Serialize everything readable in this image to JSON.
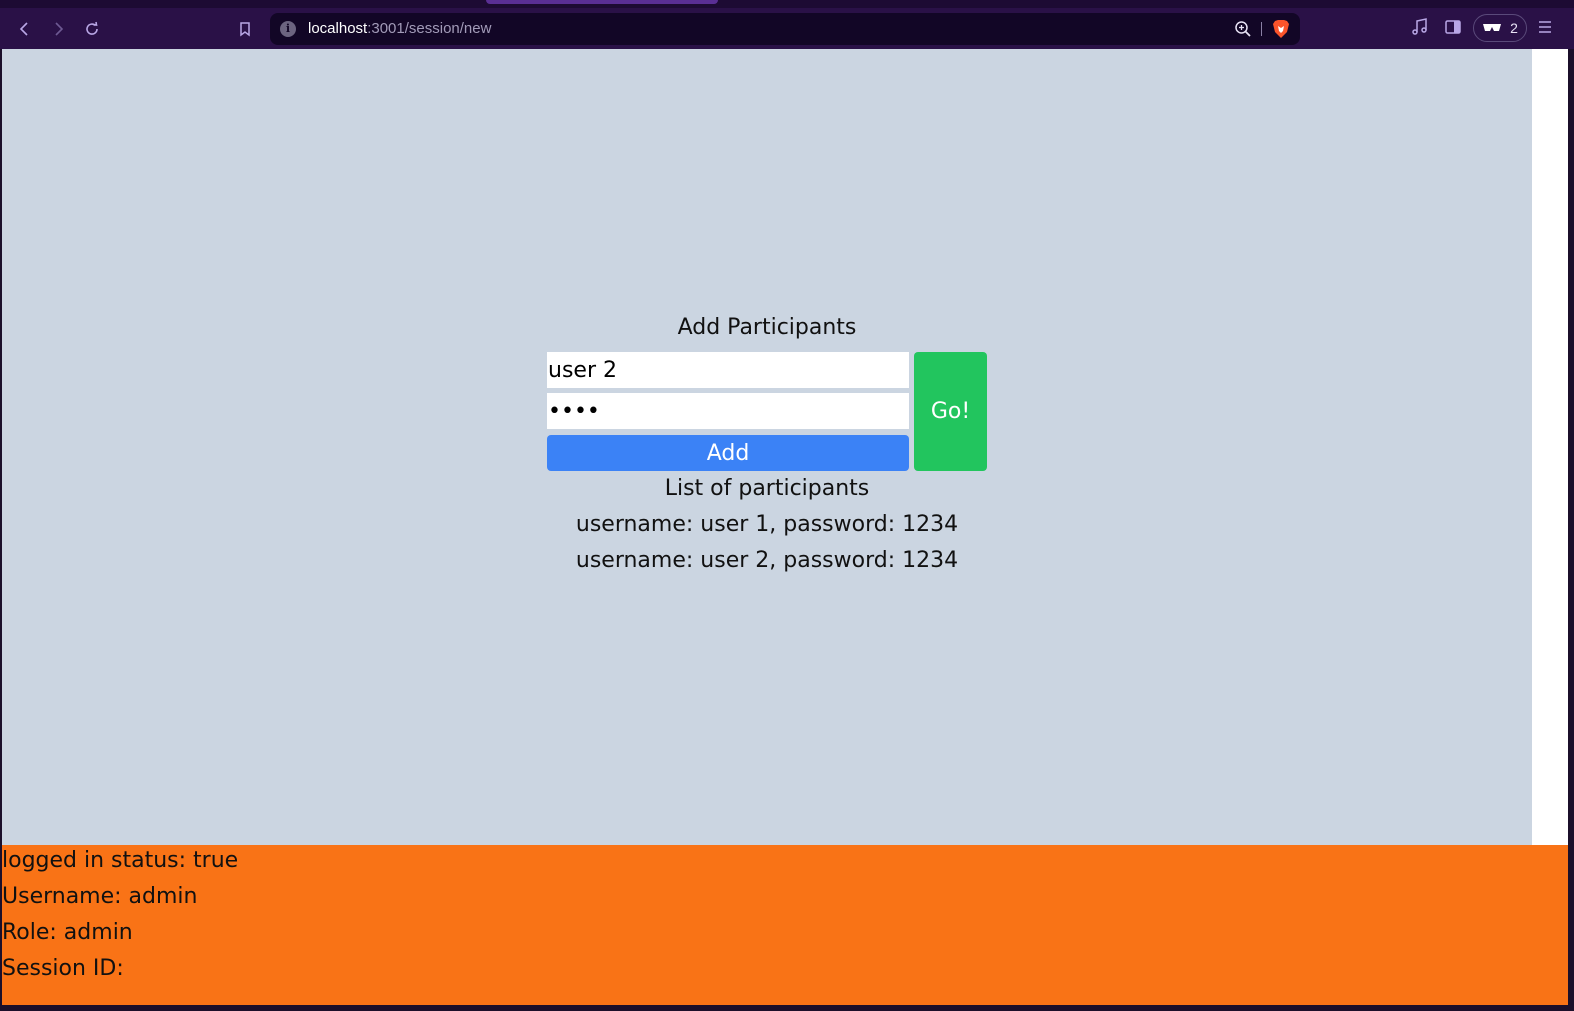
{
  "browser": {
    "url_host": "localhost",
    "url_path": ":3001/session/new",
    "wallet_count": "2",
    "icons": [
      "back-icon",
      "forward-icon",
      "reload-icon",
      "bookmark-icon",
      "site-info-icon",
      "zoom-icon",
      "brave-shield-icon",
      "media-icon",
      "sidebar-icon",
      "wallet-icon",
      "menu-icon"
    ]
  },
  "page": {
    "heading": "Add Participants",
    "username_value": "user 2",
    "password_value": "1234",
    "add_label": "Add",
    "go_label": "Go!",
    "list_title": "List of participants",
    "participants": [
      "username: user 1, password: 1234",
      "username: user 2, password: 1234"
    ]
  },
  "status": {
    "logged_in": "logged in status: true",
    "username": "Username: admin",
    "role": "Role: admin",
    "session_id": "Session ID:"
  },
  "colors": {
    "main_bg": "#cbd5e1",
    "add_button": "#3b82f6",
    "go_button": "#22c55e",
    "status_bar": "#f97316",
    "browser_chrome": "#2a1147"
  }
}
